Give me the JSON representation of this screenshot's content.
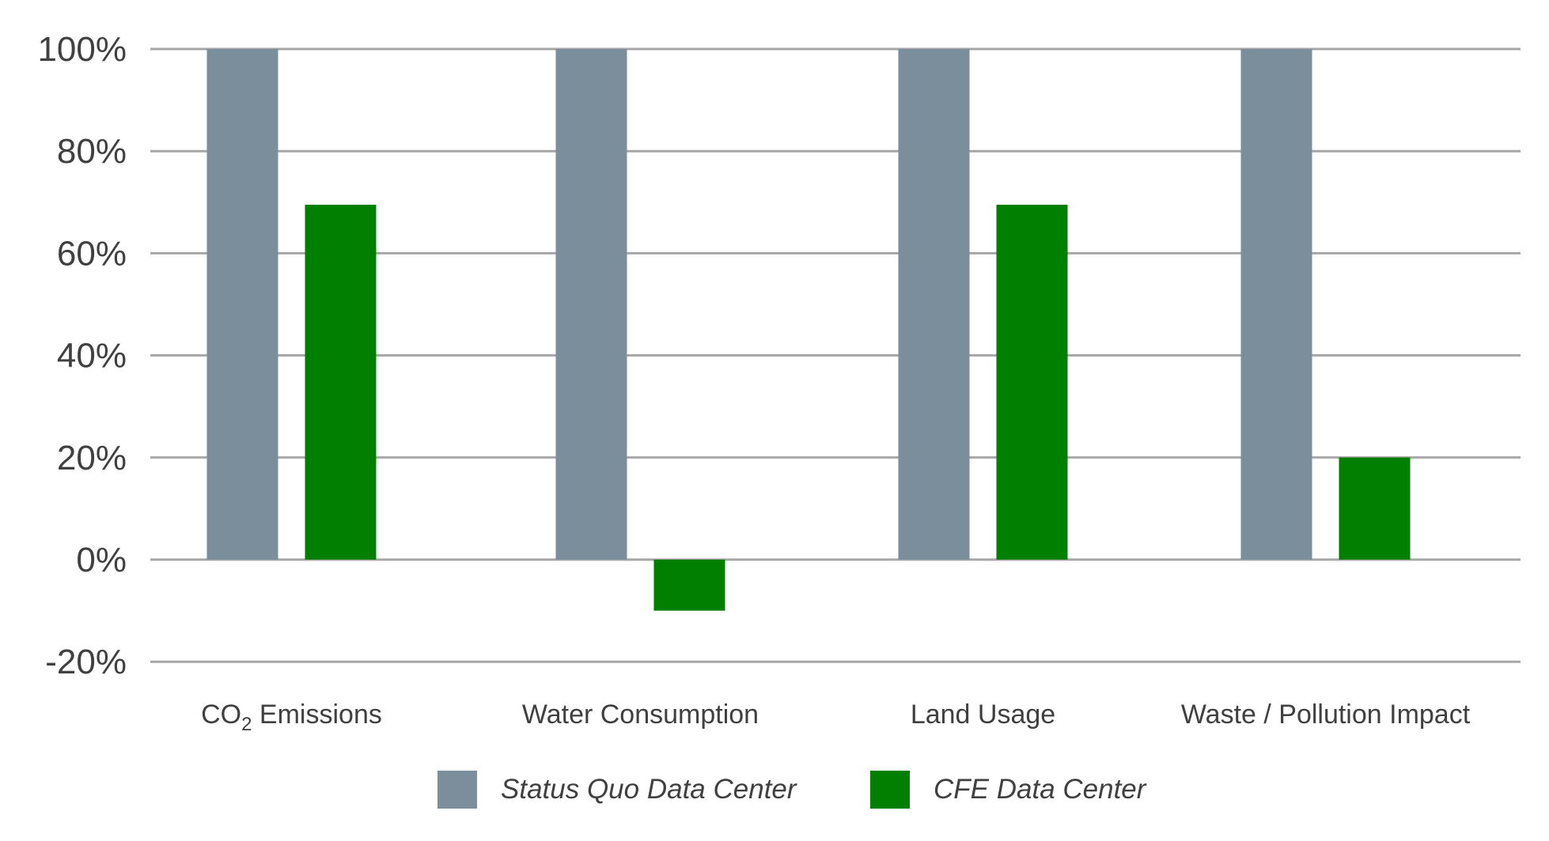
{
  "chart_data": {
    "type": "bar",
    "title": "",
    "xlabel": "",
    "ylabel": "",
    "categories": [
      "CO2 Emissions",
      "Water Consumption",
      "Land Usage",
      "Waste / Pollution Impact"
    ],
    "category_labels": [
      {
        "main": "CO",
        "sub": "2",
        "rest": " Emissions"
      },
      {
        "main": "Water Consumption",
        "sub": "",
        "rest": ""
      },
      {
        "main": "Land Usage",
        "sub": "",
        "rest": ""
      },
      {
        "main": "Waste / Pollution Impact",
        "sub": "",
        "rest": ""
      }
    ],
    "series": [
      {
        "name": "Status Quo Data Center",
        "color": "#7a8f9b",
        "values": [
          100,
          100,
          100,
          100
        ]
      },
      {
        "name": "CFE Data Center",
        "color": "#007f00",
        "values": [
          69.5,
          -10,
          69.5,
          20
        ]
      }
    ],
    "ylim": [
      -20,
      100
    ],
    "yticks": [
      100,
      80,
      60,
      40,
      20,
      0,
      -20
    ],
    "ytick_labels": [
      "100%",
      "80%",
      "60%",
      "40%",
      "20%",
      "0%",
      "-20%"
    ],
    "grid": true,
    "grid_color": "#a6a6a6",
    "legend_position": "bottom-center"
  }
}
